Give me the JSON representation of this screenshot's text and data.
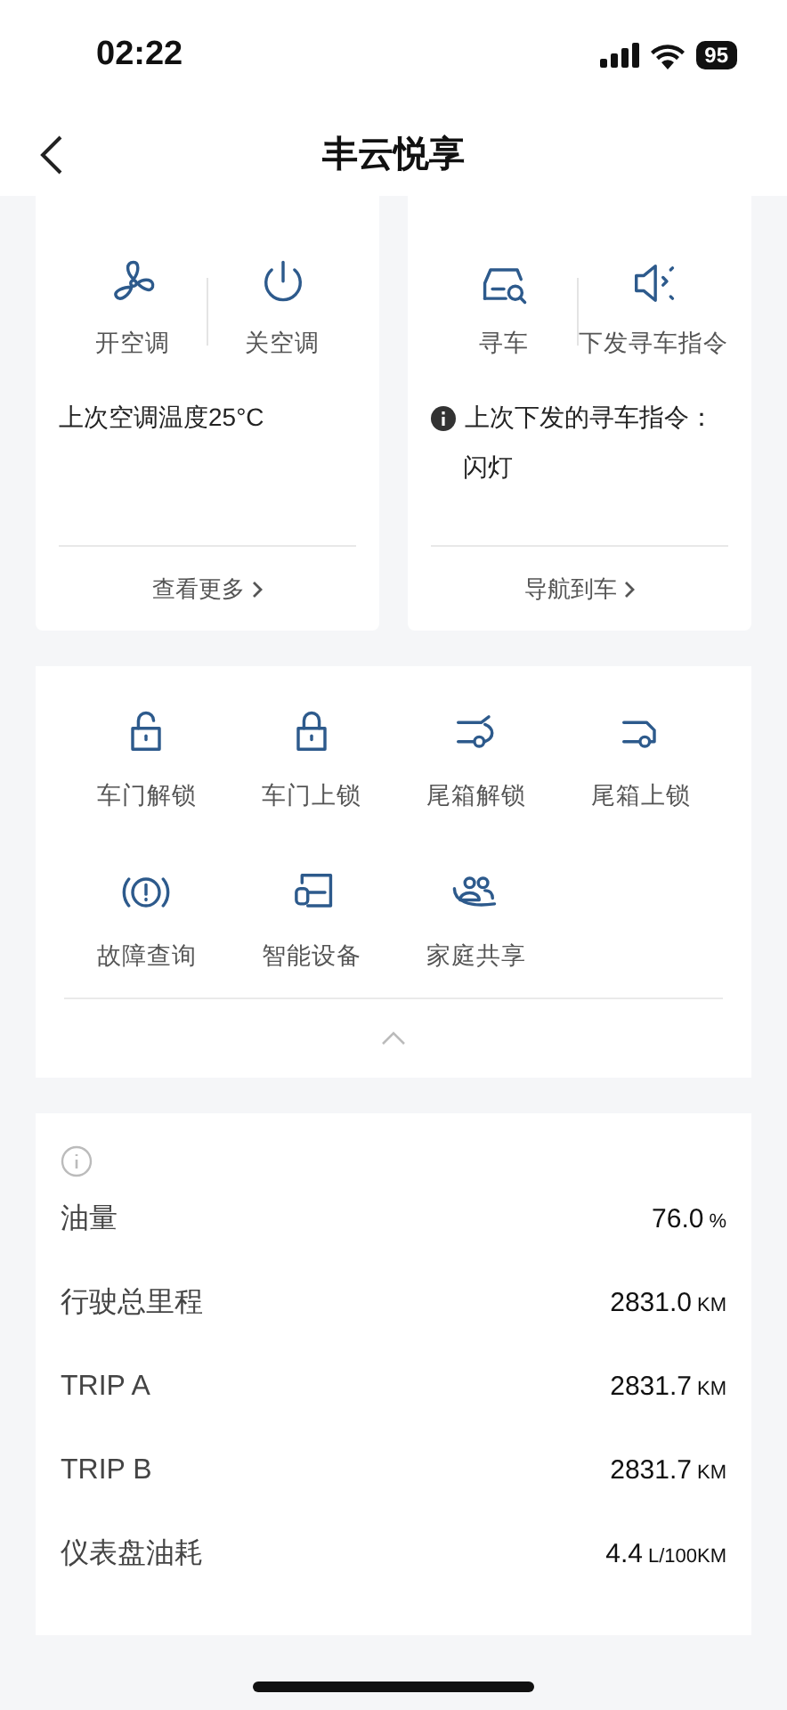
{
  "status_bar": {
    "time": "02:22",
    "battery": "95"
  },
  "header": {
    "title": "丰云悦享"
  },
  "control_cards": [
    {
      "kind": "climate",
      "actions": [
        {
          "label": "开空调"
        },
        {
          "label": "关空调"
        }
      ],
      "note": "上次空调温度25°C",
      "link": "查看更多"
    },
    {
      "kind": "find_car",
      "actions": [
        {
          "label": "寻车"
        },
        {
          "label": "下发寻车指令"
        }
      ],
      "note": "上次下发的寻车指令：",
      "note_detail": "闪灯",
      "link": "导航到车"
    }
  ],
  "quick_actions": [
    {
      "label": "车门解锁"
    },
    {
      "label": "车门上锁"
    },
    {
      "label": "尾箱解锁"
    },
    {
      "label": "尾箱上锁"
    },
    {
      "label": "故障查询"
    },
    {
      "label": "智能设备"
    },
    {
      "label": "家庭共享"
    }
  ],
  "vehicle_stats": [
    {
      "label": "油量",
      "value": "76.0",
      "unit": "%"
    },
    {
      "label": "行驶总里程",
      "value": "2831.0",
      "unit": "KM"
    },
    {
      "label": "TRIP A",
      "value": "2831.7",
      "unit": "KM"
    },
    {
      "label": "TRIP B",
      "value": "2831.7",
      "unit": "KM"
    },
    {
      "label": "仪表盘油耗",
      "value": "4.4",
      "unit": "L/100KM"
    }
  ]
}
